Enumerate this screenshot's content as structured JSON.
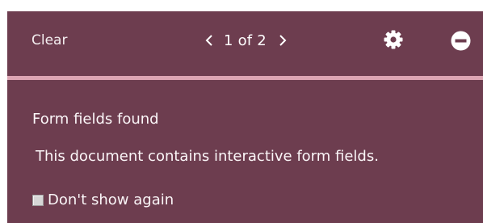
{
  "toolbar": {
    "clear_label": "Clear",
    "pager": {
      "prev_icon": "chevron-left-icon",
      "text": "1 of 2",
      "next_icon": "chevron-right-icon"
    },
    "settings_icon": "gear-icon",
    "close_icon": "minus-circle-icon"
  },
  "notice": {
    "title": "Form fields found",
    "message": "This document contains interactive form fields.",
    "checkbox_label": "Don't show again",
    "checkbox_checked": false
  },
  "colors": {
    "panel_background": "#6d3d4f",
    "divider": "#dca5b3",
    "text": "#ffffff"
  }
}
